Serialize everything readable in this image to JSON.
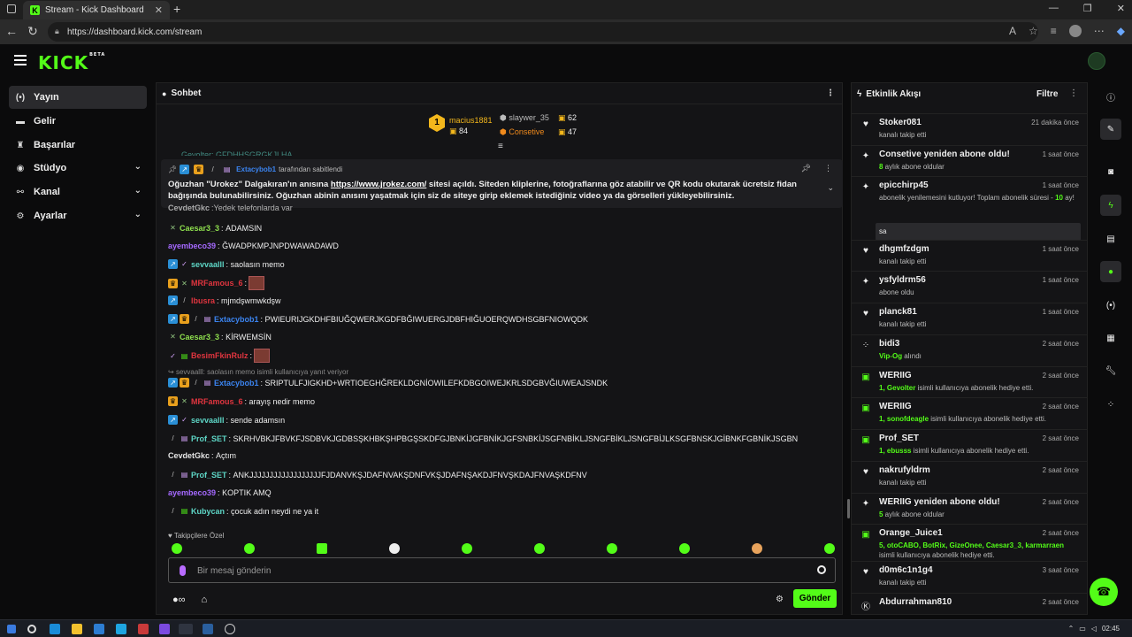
{
  "browser": {
    "tab_title": "Stream - Kick Dashboard",
    "tab_favicon": "K",
    "url": "https://dashboard.kick.com/stream"
  },
  "header": {
    "logo": "KICK",
    "logo_badge": "BETA"
  },
  "sidebar": {
    "items": [
      {
        "label": "Yayın",
        "icon": "broadcast-icon"
      },
      {
        "label": "Gelir",
        "icon": "wallet-icon"
      },
      {
        "label": "Başarılar",
        "icon": "trophy-icon"
      },
      {
        "label": "Stüdyo",
        "icon": "gamepad-icon"
      },
      {
        "label": "Kanal",
        "icon": "channel-icon"
      },
      {
        "label": "Ayarlar",
        "icon": "gear-icon"
      }
    ]
  },
  "chat": {
    "title": "Sohbet",
    "top": {
      "first": {
        "rank": "1",
        "name": "macius1881",
        "value": "84"
      },
      "second": {
        "name": "slaywer_35",
        "value": "62"
      },
      "third": {
        "name": "Consetive",
        "value": "47"
      }
    },
    "partial_line": "Gevolter: GFDHHSGRGKJLHA",
    "pinned": {
      "by_user": "Extacybob1",
      "by_suffix": "tarafından sabitlendi",
      "text_a": "Oğuzhan \"Urokez\" Dalgakıran'ın anısına ",
      "link": "https://www.jrokez.com/",
      "text_b": " sitesi açıldı. Siteden kliplerine, fotoğraflarına göz atabilir ve QR kodu okutarak ücretsiz fidan bağışında bulunabilirsiniz. Oğuzhan abinin anısını yaşatmak için siz de siteye girip eklemek istediğiniz video ya da görselleri yükleyebilirsiniz."
    },
    "messages": [
      {
        "user": "CevdetGkc",
        "text": "Yedek telefonlarda var",
        "color": "#e6e6e6"
      },
      {
        "user": "Caesar3_3",
        "text": "ADAMSIN",
        "color": "#8fe04e"
      },
      {
        "user": "ayembeco39",
        "text": "ĞWADPKMPJNPDWAWADAWD",
        "color": "#a569ff"
      },
      {
        "user": "sevvaalll",
        "text": "saolasın memo",
        "color": "#5ed6c6"
      },
      {
        "user": "MRFamous_6",
        "text": "",
        "color": "#e0353f"
      },
      {
        "user": "lbusra",
        "text": "mjmdşwmwkdşw",
        "color": "#e0353f"
      },
      {
        "user": "Extacybob1",
        "text": "PWIEURIJGKDHFBIUĞQWERJKGDFBĞIWUERGJDBFHIĞUOERQWDHSGBFNIOWQDK",
        "color": "#3b84f0"
      },
      {
        "user": "Caesar3_3",
        "text": "KİRWEMSİN",
        "color": "#8fe04e"
      },
      {
        "user": "BesimFkinRulz",
        "text": "",
        "color": "#e0353f"
      },
      {
        "reply": "sevvaalll: saolasın memo isimli kullanıcıya yanıt veriyor"
      },
      {
        "user": "Extacybob1",
        "text": "SRIPTULFJIGKHD+WRTIOEGHĞREKLDGNİOWILEFKDBGOIWEJKRLSDGBVĞIUWEAJSNDK",
        "color": "#3b84f0"
      },
      {
        "user": "MRFamous_6",
        "text": "arayış nedir memo",
        "color": "#e0353f"
      },
      {
        "user": "sevvaalll",
        "text": "sende adamsın",
        "color": "#5ed6c6"
      },
      {
        "user": "Prof_SET",
        "text": "SKRHVBKJFBVKFJSDBVKJGDBSŞKHBKŞHPBGŞSKDFGJBNKİJGFBNİKJGFSNBKİJSGFNBİKLJSNGFBİKLJSNGFBİJLKSGFBNSKJGİBNKFGBNİKJSGBN",
        "color": "#5ed6c6"
      },
      {
        "user": "CevdetGkc",
        "text": "Açtım",
        "color": "#e6e6e6"
      },
      {
        "user": "Prof_SET",
        "text": "ANKJJJJJJJJJJJJJJJJJJFJDANVKŞJDAFNVAKŞDNFVKŞJDAFNŞAKDJFNVŞKDAJFNVAŞKDFNV",
        "color": "#5ed6c6"
      },
      {
        "user": "ayembeco39",
        "text": "KOPTIK AMQ",
        "color": "#a569ff"
      },
      {
        "user": "Kubycan",
        "text": "çocuk adın neydi ne ya it",
        "color": "#5ed6c6"
      }
    ],
    "followers_only": "Takipçilere Özel",
    "input_placeholder": "Bir mesaj gönderin",
    "send_label": "Gönder"
  },
  "activity": {
    "title": "Etkinlik Akışı",
    "filter_label": "Filtre",
    "events": [
      {
        "name": "Stoker081",
        "time": "21 dakika önce",
        "desc": "kanalı takip etti",
        "icon": "heart-icon"
      },
      {
        "name": "Consetive yeniden abone oldu!",
        "time": "1 saat önce",
        "desc_g": "8",
        "desc": " aylık abone oldular",
        "icon": "sparkle-icon"
      },
      {
        "name": "epicchirp45",
        "time": "1 saat önce",
        "desc": "abonelik yenilemesini kutluyor! Toplam abonelik süresi - ",
        "desc_g2": "10",
        "desc2": " ay!",
        "reply": "sa",
        "icon": "sparkle-icon"
      },
      {
        "name": "dhgmfzdgm",
        "time": "1 saat önce",
        "desc": "kanalı takip etti",
        "icon": "heart-icon"
      },
      {
        "name": "ysfyldrm56",
        "time": "1 saat önce",
        "desc": "abone oldu",
        "icon": "sparkle-icon"
      },
      {
        "name": "planck81",
        "time": "1 saat önce",
        "desc": "kanalı takip etti",
        "icon": "heart-icon"
      },
      {
        "name": "bidi3",
        "time": "2 saat önce",
        "desc_g": "Vip-Og",
        "desc": " alındı",
        "icon": "kicks-icon"
      },
      {
        "name": "WERIIG",
        "time": "2 saat önce",
        "desc_g": "1, Gevolter",
        "desc": " isimli kullanıcıya abonelik hediye etti.",
        "icon": "gift-icon"
      },
      {
        "name": "WERIIG",
        "time": "2 saat önce",
        "desc_g": "1, sonofdeagle",
        "desc": " isimli kullanıcıya abonelik hediye etti.",
        "icon": "gift-icon"
      },
      {
        "name": "Prof_SET",
        "time": "2 saat önce",
        "desc_g": "1, ebusss",
        "desc": " isimli kullanıcıya abonelik hediye etti.",
        "icon": "gift-icon"
      },
      {
        "name": "nakrufyldrm",
        "time": "2 saat önce",
        "desc": "kanalı takip etti",
        "icon": "heart-icon"
      },
      {
        "name": "WERIIG yeniden abone oldu!",
        "time": "2 saat önce",
        "desc_g": "5",
        "desc": " aylık abone oldular",
        "icon": "sparkle-icon"
      },
      {
        "name": "Orange_Juice1",
        "time": "2 saat önce",
        "desc_g": "5, otoCABO, BotRix, GizeOnee, Caesar3_3, karmarraen",
        "desc": " isimli kullanıcıya abonelik hediye etti.",
        "icon": "gift-icon"
      },
      {
        "name": "d0m6c1n1g4",
        "time": "3 saat önce",
        "desc": "kanalı takip etti",
        "icon": "heart-icon"
      },
      {
        "name": "Abdurrahman810",
        "time": "2 saat önce",
        "desc": "",
        "icon": "kick-icon"
      }
    ]
  },
  "taskbar": {
    "time": "02:45"
  },
  "colors": {
    "accent": "#53fc18",
    "background": "#0b0b0c",
    "panel": "#141416"
  }
}
